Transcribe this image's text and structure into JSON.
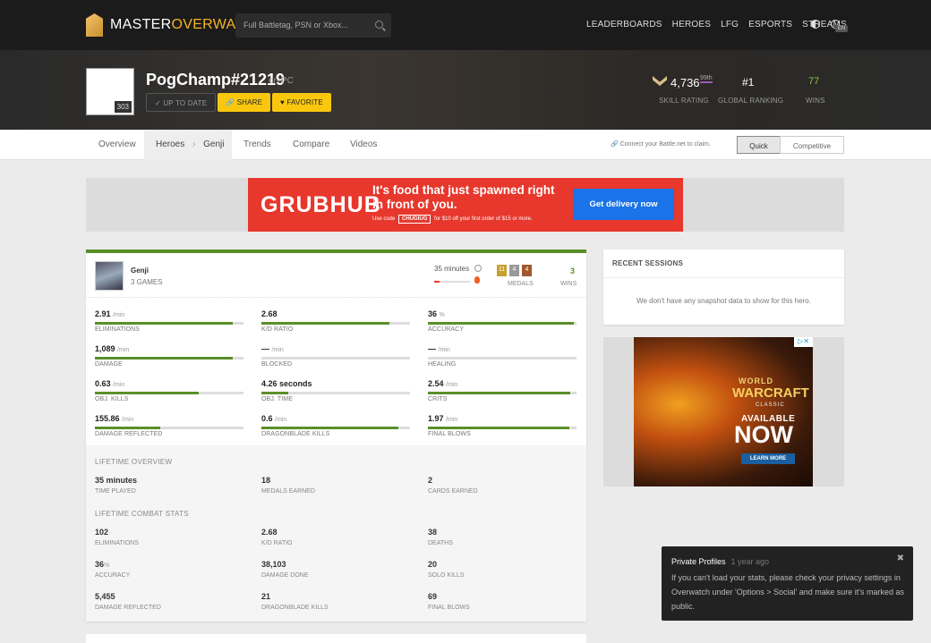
{
  "brand": {
    "a": "MASTER",
    "b": "OVERWATCH"
  },
  "search": {
    "placeholder": "Full Battletag, PSN or Xbox..."
  },
  "nav": [
    "LEADERBOARDS",
    "HEROES",
    "LFG",
    "ESPORTS",
    "STREAMS"
  ],
  "lang": "EN",
  "profile": {
    "name": "PogChamp#21219",
    "platform": "on PC",
    "level": "303",
    "btn_up": "UP TO DATE",
    "btn_share": "SHARE",
    "btn_fav": "FAVORITE",
    "sr": "4,736",
    "sr_pct": "99th",
    "sr_label": "SKILL RATING",
    "rank": "#1",
    "rank_label": "GLOBAL RANKING",
    "wins": "77",
    "wins_label": "WINS"
  },
  "tabs": {
    "overview": "Overview",
    "heroes": "Heroes",
    "genji": "Genji",
    "trends": "Trends",
    "compare": "Compare",
    "videos": "Videos"
  },
  "connect": "Connect your Battle.net to claim.",
  "mode": {
    "quick": "Quick",
    "competitive": "Competitive"
  },
  "ad": {
    "logo": "GRUBHUB",
    "tag": "It's food that just spawned right in front of you.",
    "code_pre": "Use code",
    "code": "CHUGIUG",
    "code_post": "for $10 off your first order of $15 or more.",
    "cta": "Get delivery now"
  },
  "hero": {
    "name": "Genji",
    "games": "3 GAMES",
    "time": "35 minutes",
    "medals": [
      "11",
      "4",
      "4"
    ],
    "medals_label": "MEDALS",
    "wins": "3",
    "wins_label": "WINS"
  },
  "stats": [
    {
      "v": "2.91",
      "u": "/min",
      "l": "ELIMINATIONS",
      "p": 0.93
    },
    {
      "v": "2.68",
      "u": "",
      "l": "K/D RATIO",
      "p": 0.86
    },
    {
      "v": "36",
      "u": "%",
      "l": "ACCURACY",
      "p": 0.98
    },
    {
      "v": "1,089",
      "u": "/min",
      "l": "DAMAGE",
      "p": 0.93
    },
    {
      "v": "—",
      "u": "/min",
      "l": "BLOCKED",
      "p": 0
    },
    {
      "v": "—",
      "u": "/min",
      "l": "HEALING",
      "p": 0
    },
    {
      "v": "0.63",
      "u": "/min",
      "l": "OBJ. KILLS",
      "p": 0.7
    },
    {
      "v": "4.26 seconds",
      "u": "",
      "l": "OBJ. TIME",
      "p": 0.18
    },
    {
      "v": "2.54",
      "u": "/min",
      "l": "CRITS",
      "p": 0.96
    },
    {
      "v": "155.86",
      "u": "/min",
      "l": "DAMAGE REFLECTED",
      "p": 0.44
    },
    {
      "v": "0.6",
      "u": "/min",
      "l": "DRAGONBLADE KILLS",
      "p": 0.92
    },
    {
      "v": "1.97",
      "u": "/min",
      "l": "FINAL BLOWS",
      "p": 0.95
    }
  ],
  "lifetime": {
    "overview_title": "LIFETIME OVERVIEW",
    "overview": [
      {
        "v": "35 minutes",
        "l": "TIME PLAYED"
      },
      {
        "v": "18",
        "l": "MEDALS EARNED"
      },
      {
        "v": "2",
        "l": "CARDS EARNED"
      }
    ],
    "combat_title": "LIFETIME COMBAT STATS",
    "combat": [
      {
        "v": "102",
        "u": "",
        "l": "ELIMINATIONS"
      },
      {
        "v": "2.68",
        "u": "",
        "l": "K/D RATIO"
      },
      {
        "v": "38",
        "u": "",
        "l": "DEATHS"
      },
      {
        "v": "36",
        "u": "%",
        "l": "ACCURACY"
      },
      {
        "v": "38,103",
        "u": "",
        "l": "DAMAGE DONE"
      },
      {
        "v": "20",
        "u": "",
        "l": "SOLO KILLS"
      },
      {
        "v": "5,455",
        "u": "",
        "l": "DAMAGE REFLECTED"
      },
      {
        "v": "21",
        "u": "",
        "l": "DRAGONBLADE KILLS"
      },
      {
        "v": "69",
        "u": "",
        "l": "FINAL BLOWS"
      }
    ]
  },
  "recent": {
    "title": "RECENT SESSIONS",
    "empty": "We don't have any snapshot data to show for this hero."
  },
  "wow": {
    "world": "WORLD",
    "warcraft": "WARCRAFT",
    "classic": "CLASSIC",
    "available": "AVAILABLE",
    "now": "NOW",
    "learn": "LEARN MORE"
  },
  "toast": {
    "title": "Private Profiles",
    "time": "1 year ago",
    "body": "If you can't load your stats, please check your privacy settings in Overwatch under 'Options > Social' and make sure it's marked as public."
  }
}
